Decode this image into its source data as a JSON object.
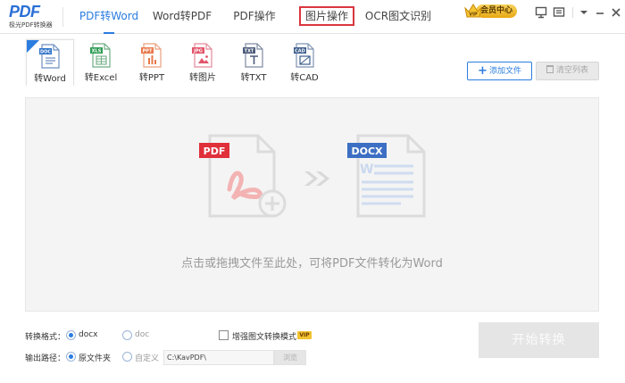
{
  "app": {
    "logo_text": "PDF",
    "logo_subtitle": "极光PDF转换器"
  },
  "nav": {
    "tabs": [
      {
        "label": "PDF转Word",
        "active": true
      },
      {
        "label": "Word转PDF",
        "active": false
      },
      {
        "label": "PDF操作",
        "active": false
      },
      {
        "label": "图片操作",
        "active": false,
        "highlighted": true
      },
      {
        "label": "OCR图文识别",
        "active": false
      }
    ]
  },
  "vip": {
    "label": "会员中心",
    "crown_text": "VIP"
  },
  "window_controls": [
    "feedback-icon",
    "message-icon",
    "menu-icon",
    "minimize-icon",
    "close-icon"
  ],
  "formats": [
    {
      "label": "转Word",
      "icon_tag": "DOC",
      "color": "#2b6fc8",
      "active": true
    },
    {
      "label": "转Excel",
      "icon_tag": "XLS",
      "color": "#2e9d54",
      "active": false
    },
    {
      "label": "转PPT",
      "icon_tag": "PPT",
      "color": "#e9784a",
      "active": false
    },
    {
      "label": "转图片",
      "icon_tag": "JPG",
      "color": "#e2546a",
      "active": false
    },
    {
      "label": "转TXT",
      "icon_tag": "TXT",
      "color": "#4b5b7a",
      "active": false
    },
    {
      "label": "转CAD",
      "icon_tag": "CAD",
      "color": "#3c5d8c",
      "active": false
    }
  ],
  "toolbar": {
    "add_file_label": "添加文件",
    "clear_list_label": "清空列表"
  },
  "dropzone": {
    "source_tag": "PDF",
    "target_tag": "DOCX",
    "hint": "点击或拖拽文件至此处，可将PDF文件转化为Word"
  },
  "options": {
    "format_label": "转换格式：",
    "format_choices": [
      {
        "label": "docx",
        "selected": true
      },
      {
        "label": "doc",
        "selected": false
      }
    ],
    "enhance_label": "增强图文转换模式",
    "enhance_checked": false,
    "enhance_vip": "VIP",
    "output_label": "输出路径：",
    "output_choices": [
      {
        "label": "原文件夹",
        "selected": true
      },
      {
        "label": "自定义",
        "selected": false
      }
    ],
    "custom_path": "C:\\KavPDF\\",
    "browse_label": "浏览"
  },
  "start_button_label": "开始转换",
  "colors": {
    "accent": "#2b7de0",
    "highlight_box": "#d9363e",
    "pdf_red": "#e0303a",
    "docx_blue": "#3c6fc4"
  }
}
